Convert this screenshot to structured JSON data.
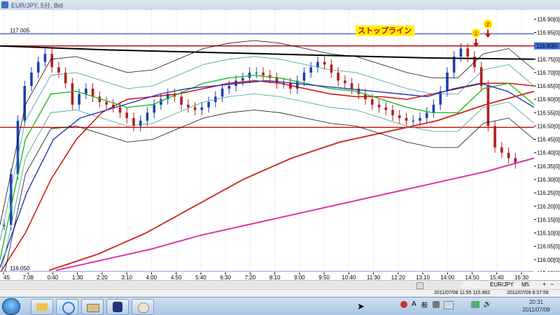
{
  "window": {
    "title": "EUR/JPY, 5分, Bid"
  },
  "chart_data": {
    "type": "line",
    "title": "EUR/JPY, 5分, Bid",
    "ylim": [
      115.955,
      116.935
    ],
    "y_ticks": [
      "116.90[0]",
      "116.85[0]",
      "116.80[0]",
      "116.75[0]",
      "116.70[0]",
      "116.65[0]",
      "116.60[0]",
      "116.55[0]",
      "116.50[0]",
      "116.45[0]",
      "116.40[0]",
      "116.35[0]",
      "116.30[0]",
      "116.25[0]",
      "116.20[0]",
      "116.15[0]",
      "116.10[0]",
      "116.05[0]",
      "116.00[0]",
      "115.95[0]"
    ],
    "x_ticks": [
      "45",
      "7.08",
      "0:40",
      "1:30",
      "2:20",
      "3:10",
      "4:00",
      "4:50",
      "5:40",
      "6:30",
      "7:20",
      "8:10",
      "9:00",
      "9:50",
      "10:40",
      "11:30",
      "12:20",
      "13:10",
      "14:00",
      "14:50",
      "15:40",
      "16:30"
    ],
    "price_tag": "116.80[0",
    "hlines": [
      {
        "label": "117.005",
        "value": 116.845,
        "color": "#3344cc"
      },
      {
        "label": "",
        "value": 116.8,
        "color": "#cc1111"
      },
      {
        "label": "",
        "value": 116.495,
        "color": "#cc1111"
      },
      {
        "label": "116.050",
        "value": 115.955,
        "color": "#3344cc"
      }
    ],
    "candles": [
      116.13,
      116.32,
      116.52,
      116.65,
      116.7,
      116.74,
      116.77,
      116.72,
      116.7,
      116.66,
      116.58,
      116.62,
      116.64,
      116.61,
      116.59,
      116.58,
      116.57,
      116.55,
      116.53,
      116.5,
      116.52,
      116.55,
      116.58,
      116.6,
      116.62,
      116.61,
      116.58,
      116.57,
      116.56,
      116.57,
      116.59,
      116.61,
      116.64,
      116.65,
      116.67,
      116.68,
      116.7,
      116.7,
      116.69,
      116.68,
      116.66,
      116.66,
      116.64,
      116.67,
      116.7,
      116.72,
      116.74,
      116.73,
      116.7,
      116.67,
      116.66,
      116.64,
      116.62,
      116.6,
      116.58,
      116.57,
      116.56,
      116.54,
      116.53,
      116.52,
      116.52,
      116.53,
      116.55,
      116.58,
      116.63,
      116.7,
      116.76,
      116.79,
      116.76,
      116.72,
      116.65,
      116.5,
      116.42,
      116.4,
      116.38,
      116.36
    ],
    "series": [
      {
        "name": "",
        "color": "#cc0000",
        "values": [
          115.95,
          116.1,
          116.3,
          116.45,
          116.55,
          116.6,
          116.61,
          116.62,
          116.64,
          116.66,
          116.67,
          116.66,
          116.64,
          116.62,
          116.61,
          116.61,
          116.6,
          116.62,
          116.64,
          116.66,
          116.66,
          116.65
        ]
      },
      {
        "name": "",
        "color": "#22bb22",
        "values": [
          116.0,
          116.45,
          116.62,
          116.63,
          116.6,
          116.57,
          116.58,
          116.62,
          116.66,
          116.68,
          116.69,
          116.68,
          116.66,
          116.64,
          116.63,
          116.6,
          116.57,
          116.55,
          116.55,
          116.64,
          116.66,
          116.58
        ]
      },
      {
        "name": "",
        "color": "#2233bb",
        "values": [
          115.97,
          116.25,
          116.45,
          116.53,
          116.56,
          116.59,
          116.62,
          116.64,
          116.65,
          116.66,
          116.67,
          116.66,
          116.65,
          116.64,
          116.63,
          116.62,
          116.61,
          116.64,
          116.66,
          116.63,
          116.57
        ]
      },
      {
        "name": "",
        "color": "#cc3322",
        "values": [
          115.96,
          116.02,
          116.1,
          116.2,
          116.3,
          116.38,
          116.44,
          116.48,
          116.52,
          116.58,
          116.63
        ]
      },
      {
        "name": "",
        "color": "#dd33aa",
        "values": [
          115.96,
          116.0,
          116.04,
          116.09,
          116.13,
          116.17,
          116.21,
          116.25,
          116.29,
          116.33,
          116.38
        ]
      },
      {
        "name": "",
        "color": "#000000",
        "values": [
          116.8,
          116.785,
          116.775,
          116.765,
          116.755,
          116.75
        ]
      }
    ],
    "annotations": {
      "stop_line": "ストップライン",
      "marker1": "①",
      "marker2": "②"
    }
  },
  "toolbar": {
    "symbol": "EUR/JPY",
    "timeframe": "M5"
  },
  "status": {
    "left": "2011/07/08 11:55   115.962",
    "right": "2011/07/09 6:37:58"
  },
  "taskbar": {
    "time": "20:31",
    "date": "2011/07/09"
  }
}
